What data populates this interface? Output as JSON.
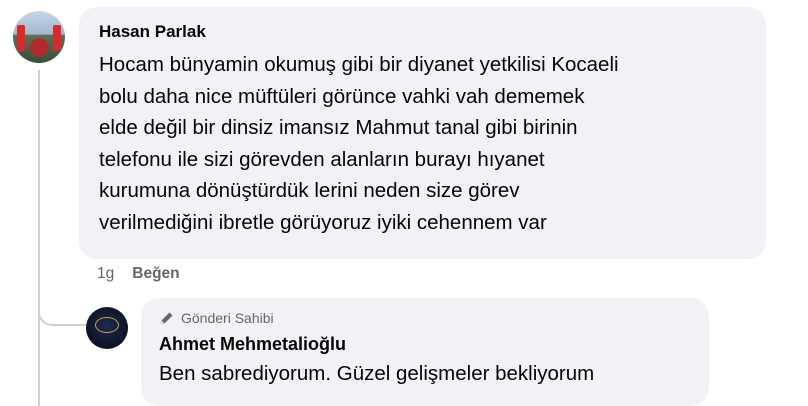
{
  "comment": {
    "author": "Hasan Parlak",
    "text": "Hocam bünyamin okumuş gibi bir diyanet yetkilisi Kocaeli\nbolu daha nice müftüleri görünce vahki vah dememek\nelde değil bir dinsiz imansız Mahmut tanal gibi birinin\ntelefonu ile sizi görevden alanların burayı hıyanet\nkurumuna dönüştürdük lerini neden size görev\nverilmediğini ibretle görüyoruz iyiki cehennem var",
    "timestamp": "1g",
    "like_label": "Beğen"
  },
  "reply": {
    "badge_icon": "pencil-icon",
    "badge_label": "Gönderi Sahibi",
    "author": "Ahmet Mehmetalioğlu",
    "text": "Ben sabrediyorum. Güzel gelişmeler bekliyorum"
  },
  "colors": {
    "bubble": "#f0f2f5",
    "secondary_text": "#65676b",
    "thread_line": "#ced0d4"
  }
}
